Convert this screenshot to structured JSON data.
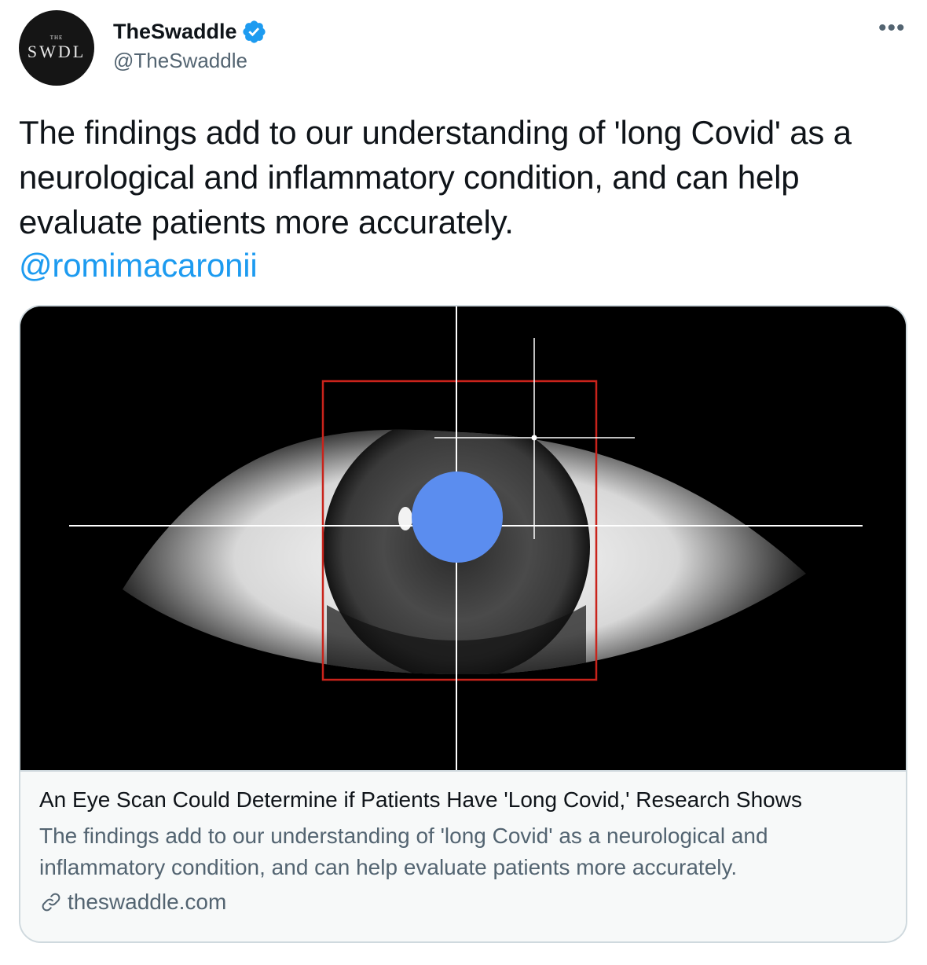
{
  "author": {
    "avatar_top": "THE",
    "avatar_text": "SWDL",
    "display_name": "TheSwaddle",
    "handle": "@TheSwaddle",
    "verified_icon": "verified-badge-icon"
  },
  "menu": {
    "more_label": "•••",
    "icon": "more-horizontal-icon"
  },
  "tweet": {
    "text": "The findings add to our understanding of 'long Covid' as a neurological and inflammatory condition, and can help evaluate patients more accurately.",
    "mention": "@romimacaronii"
  },
  "card": {
    "image_icon": "eye-scan-image",
    "title": "An Eye Scan Could Determine if Patients Have 'Long Covid,' Research Shows",
    "description": "The findings add to our understanding of 'long Covid' as a neurological and inflammatory condition, and can help evaluate patients more accurately.",
    "domain": "theswaddle.com",
    "domain_icon": "link-icon"
  },
  "colors": {
    "text": "#0f1419",
    "muted": "#536471",
    "link": "#1d9bf0",
    "border": "#cfd9de",
    "card_bg": "#f7f9f9",
    "scan_frame": "#c9231b",
    "scan_dot": "#5b8def"
  }
}
